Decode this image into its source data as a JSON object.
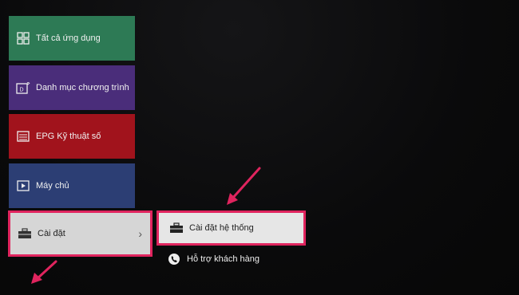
{
  "menu": {
    "items": [
      {
        "label": "Tất cả ứng dụng",
        "icon": "grid-apps-icon",
        "color": "#2d7a55"
      },
      {
        "label": "Danh mục chương trình",
        "icon": "program-guide-icon",
        "color": "#4a2d7a"
      },
      {
        "label": "EPG Kỹ thuật số",
        "icon": "epg-list-icon",
        "color": "#a1131c"
      },
      {
        "label": "Máy chủ",
        "icon": "media-server-icon",
        "color": "#2c3e74"
      },
      {
        "label": "Cài đặt",
        "icon": "toolbox-icon",
        "color": "#d6d6d6",
        "selected": true
      }
    ]
  },
  "submenu": {
    "items": [
      {
        "label": "Cài đặt hệ thống",
        "icon": "toolbox-icon",
        "selected": true
      },
      {
        "label": "Hỗ trợ khách hàng",
        "icon": "phone-icon"
      }
    ]
  },
  "highlight_color": "#e0245e"
}
